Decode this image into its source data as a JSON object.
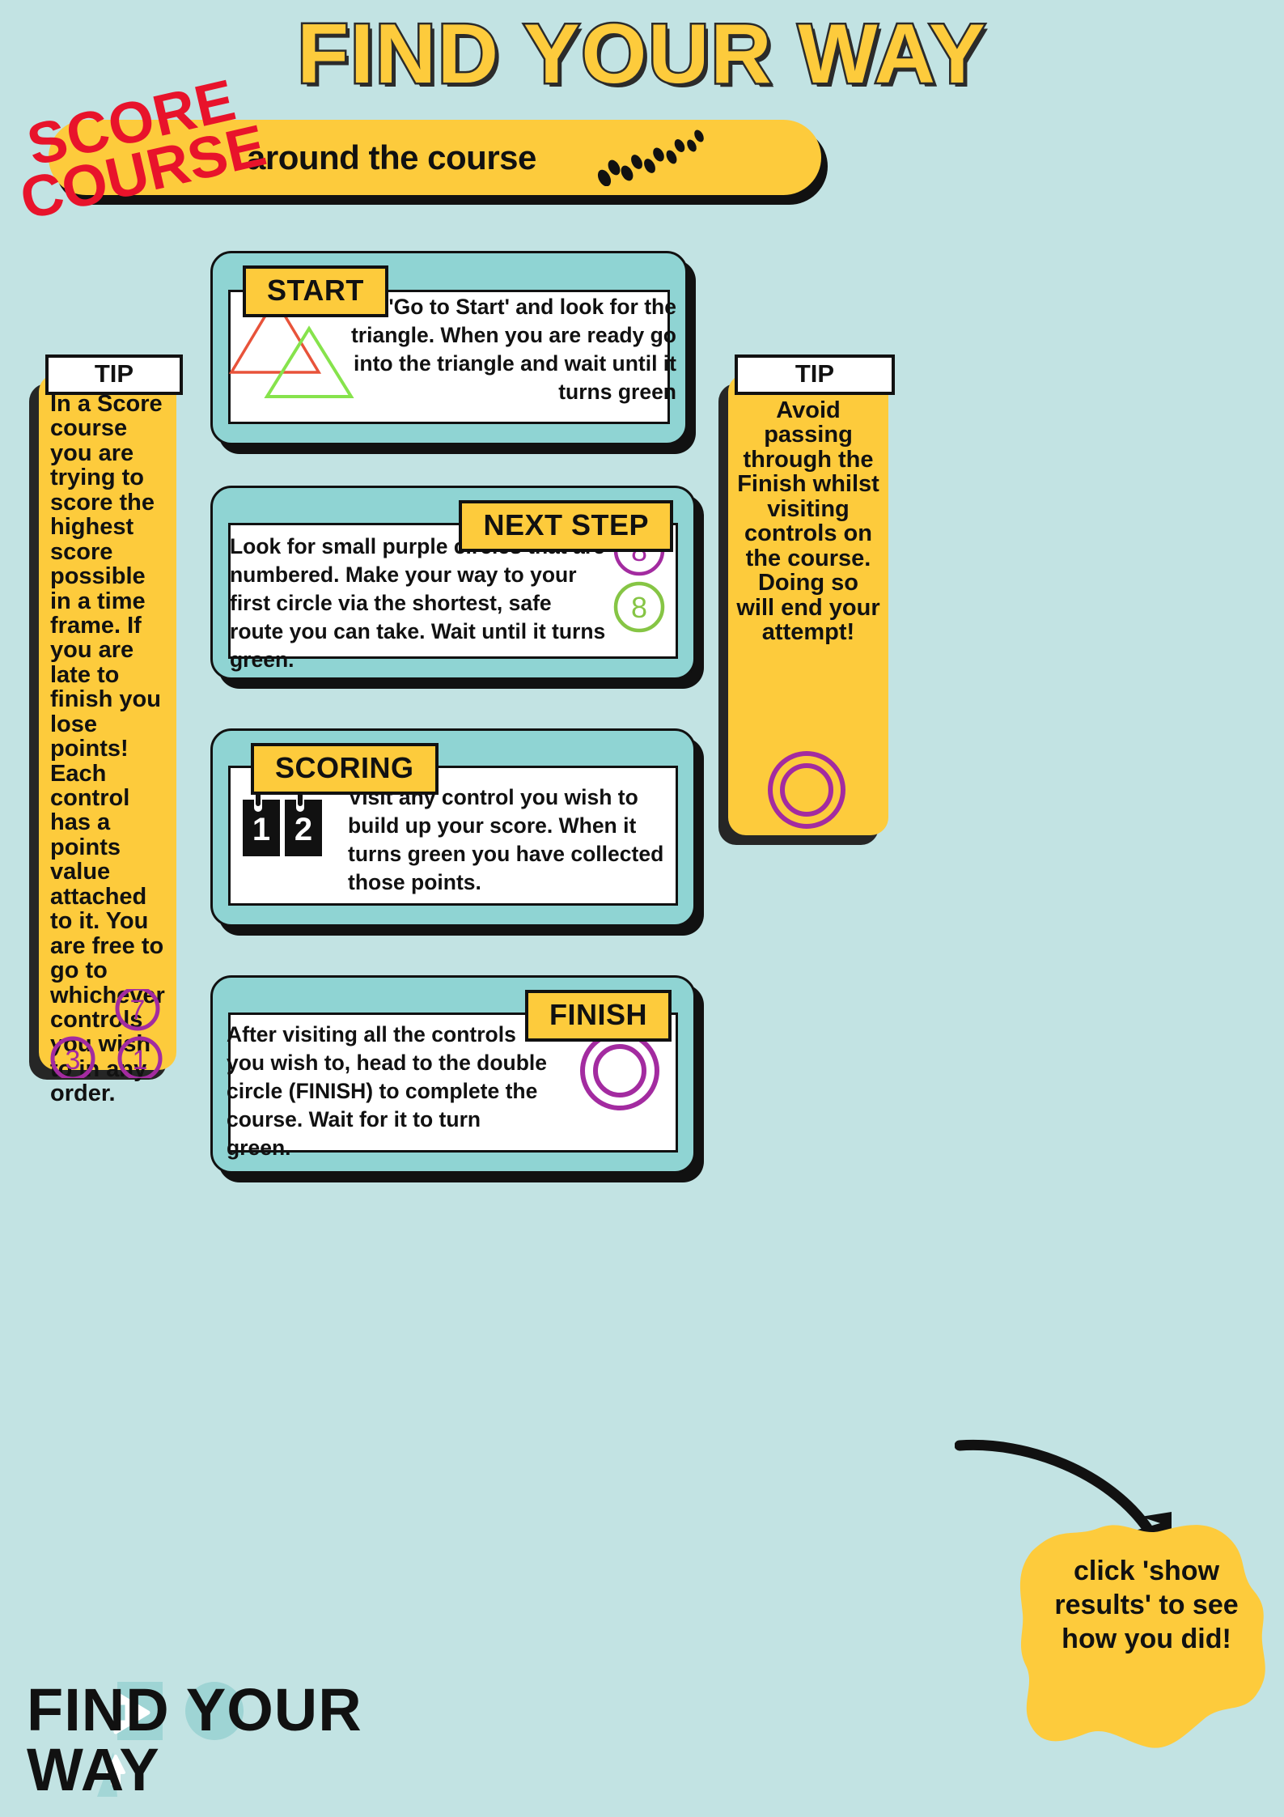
{
  "header": {
    "title": "FIND YOUR WAY",
    "badge_line1": "SCORE",
    "badge_line2": "COURSE",
    "banner_text": "around the course",
    "footprints_icon": "footprints-icon"
  },
  "cards": [
    {
      "id": "start",
      "badge": "START",
      "text": "Click 'Go to Start' and look for the triangle. When you are ready go into the triangle and wait until it turns green",
      "icon": "triangle-control-icon",
      "icon_colors": [
        "#e8533a",
        "#86e34c"
      ]
    },
    {
      "id": "next-step",
      "badge": "NEXT STEP",
      "text": "Look for small purple circles that are numbered. Make your way to your first circle via the shortest, safe route you can take. Wait until it turns green.",
      "icon": "numbered-circle-icon",
      "icon_numbers": [
        "8",
        "8"
      ],
      "icon_colors": [
        "#a32ba0",
        "#86c545"
      ]
    },
    {
      "id": "scoring",
      "badge": "SCORING",
      "text": "Visit any control you wish to build up your score. When it turns green you have collected those points.",
      "icon": "scoreboard-icon",
      "icon_digits": [
        "1",
        "2"
      ]
    },
    {
      "id": "finish",
      "badge": "FINISH",
      "text": "After visiting all the controls you wish to, head to the double circle (FINISH) to complete the course. Wait for it to turn green.",
      "icon": "double-circle-finish-icon",
      "icon_color": "#a32ba0"
    }
  ],
  "tips": {
    "left": {
      "heading": "TIP",
      "text": "In a Score course you are trying to score the highest score possible in a time frame. If you are late to finish you lose points! Each control has a points value attached to it. You are free to go to whichever controls you wish to in any order.",
      "circle_numbers": [
        "7",
        "3",
        "1"
      ],
      "circle_color": "#a32ba0"
    },
    "right": {
      "heading": "TIP",
      "text": "Avoid passing through the Finish whilst visiting controls on the course. Doing so will end your attempt!",
      "icon": "double-circle-finish-icon",
      "icon_color": "#a32ba0"
    }
  },
  "callout": {
    "text": "click 'show results' to see how you did!",
    "arrow_icon": "curved-arrow-icon"
  },
  "logo": {
    "line1": "FIND YOUR",
    "line2": "WAY",
    "marker_icon": "map-marker-icon",
    "arrow_icon": "play-arrow-icon"
  },
  "colors": {
    "background": "#c2e3e3",
    "yellow": "#fdcb3c",
    "teal": "#8fd4d3",
    "red": "#e8132b",
    "purple": "#a32ba0",
    "green": "#86e34c",
    "dark": "#111111"
  }
}
